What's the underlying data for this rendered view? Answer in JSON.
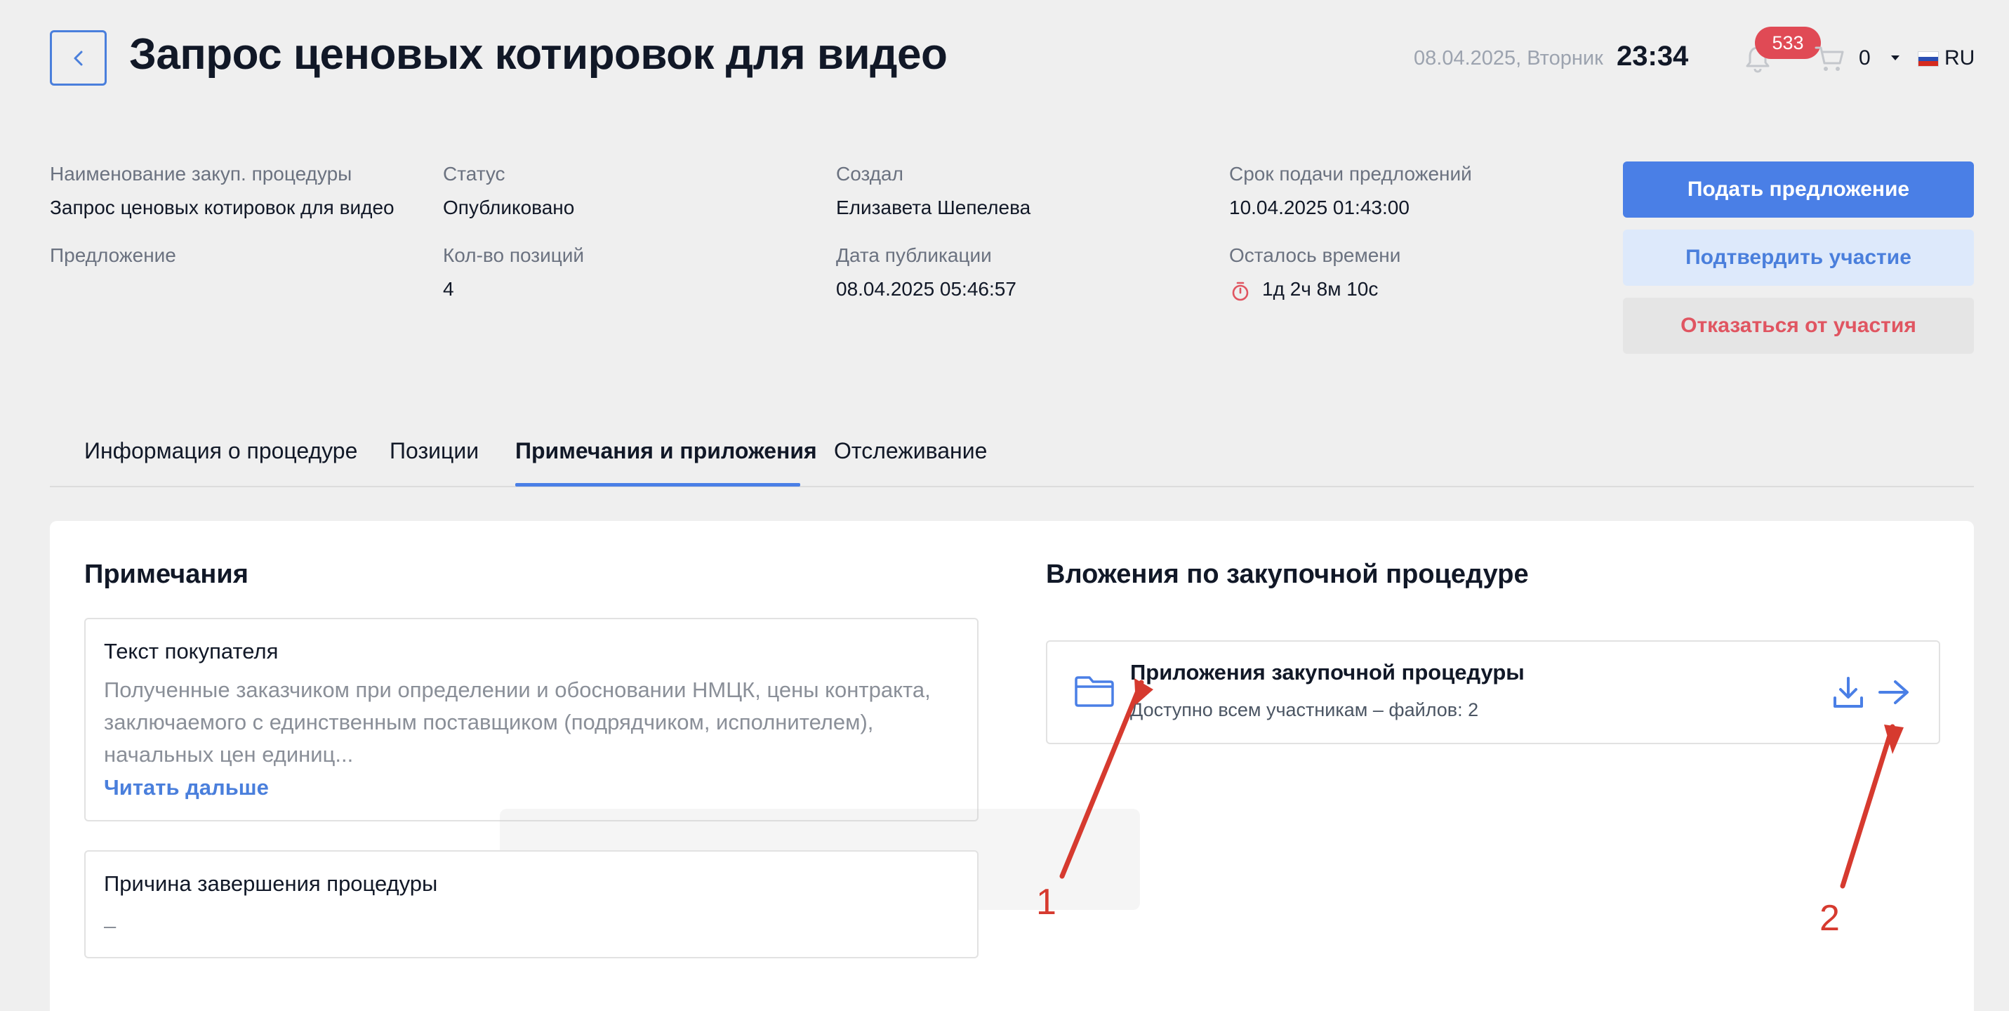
{
  "header": {
    "title": "Запрос ценовых котировок для видео",
    "date": "08.04.2025, Вторник",
    "time": "23:34",
    "notifications_count": "533",
    "cart_count": "0",
    "language": "RU"
  },
  "info": {
    "procedure_name_label": "Наименование закуп. процедуры",
    "procedure_name_value": "Запрос ценовых котировок для видео",
    "status_label": "Статус",
    "status_value": "Опубликовано",
    "creator_label": "Создал",
    "creator_value": "Елизавета Шепелева",
    "deadline_label": "Срок подачи предложений",
    "deadline_value": "10.04.2025 01:43:00",
    "offer_label": "Предложение",
    "positions_label": "Кол-во позиций",
    "positions_value": "4",
    "publish_date_label": "Дата публикации",
    "publish_date_value": "08.04.2025 05:46:57",
    "time_left_label": "Осталось времени",
    "time_left_value": "1д 2ч 8м 10с"
  },
  "actions": {
    "submit_offer": "Подать предложение",
    "confirm_participation": "Подтвердить участие",
    "decline_participation": "Отказаться от участия"
  },
  "tabs": [
    {
      "label": "Информация о процедуре"
    },
    {
      "label": "Позиции"
    },
    {
      "label": "Примечания и приложения"
    },
    {
      "label": "Отслеживание"
    }
  ],
  "notes": {
    "title": "Примечания",
    "buyer_text_title": "Текст покупателя",
    "buyer_text": "Полученные заказчиком при определении и обосновании НМЦК, цены контракта, заключаемого с единственным поставщиком (подрядчиком, исполнителем), начальных цен единиц...",
    "read_more": "Читать дальше",
    "completion_reason_title": "Причина завершения процедуры",
    "completion_reason_value": "–"
  },
  "attachments": {
    "title": "Вложения по закупочной процедуре",
    "item_title": "Приложения закупочной процедуры",
    "item_subtitle": "Доступно всем участникам – файлов: 2"
  },
  "annotations": {
    "label_1": "1",
    "label_2": "2",
    "color": "#d63a2f"
  },
  "colors": {
    "accent": "#4a7fe6",
    "danger": "#e05561",
    "badge": "#e04a55"
  }
}
